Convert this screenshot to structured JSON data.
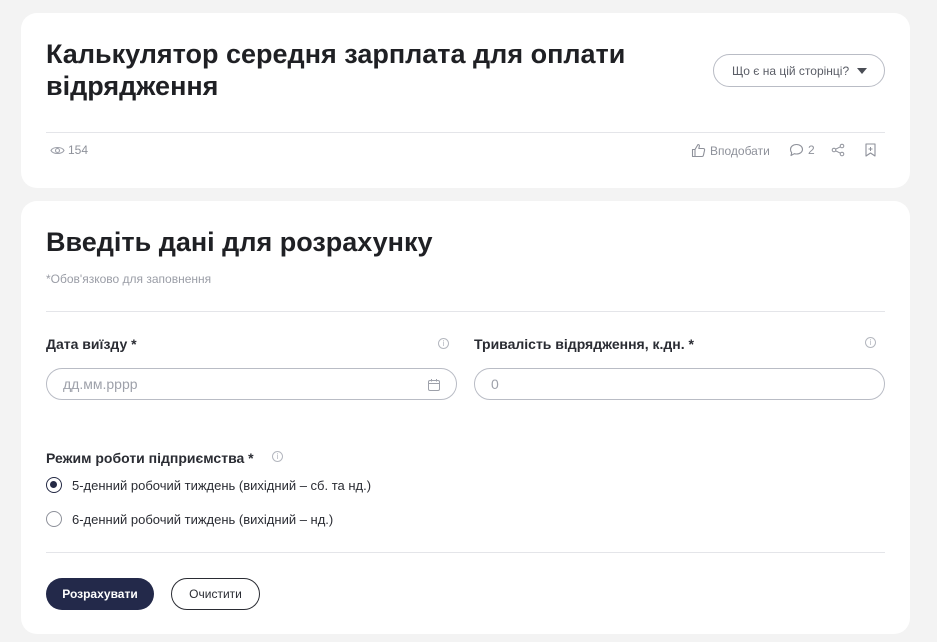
{
  "header": {
    "title": "Калькулятор середня зарплата для оплати відрядження",
    "help_button": "Що є на цій сторінці?",
    "views": "154",
    "like_label": "Вподобати",
    "comments_count": "2"
  },
  "form": {
    "heading": "Введіть дані для розрахунку",
    "required_note": "*Обов'язково для заповнення",
    "departure_date": {
      "label": "Дата виїзду *",
      "placeholder": "дд.мм.рррр",
      "value": ""
    },
    "duration": {
      "label": "Тривалість відрядження, к.дн. *",
      "placeholder": "0",
      "value": ""
    },
    "work_mode": {
      "label": "Режим роботи підприємства *",
      "options": [
        {
          "label": "5-денний робочий тиждень (вихідний – сб. та нд.)",
          "checked": true
        },
        {
          "label": "6-денний робочий тиждень (вихідний – нд.)",
          "checked": false
        }
      ]
    },
    "calculate_button": "Розрахувати",
    "clear_button": "Очистити"
  }
}
